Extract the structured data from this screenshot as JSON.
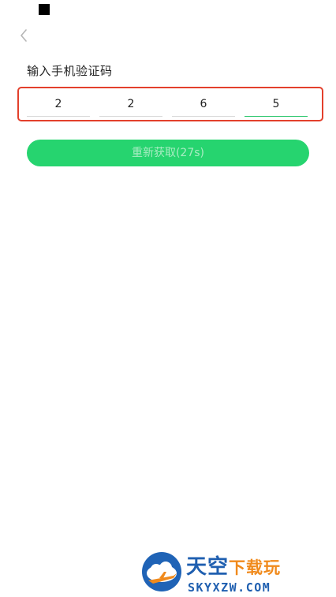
{
  "status_bar": {
    "indicator_icon": "square-icon"
  },
  "nav": {
    "back_icon": "chevron-left-icon"
  },
  "verification": {
    "title": "输入手机验证码",
    "digits": [
      "2",
      "2",
      "6",
      "5"
    ],
    "active_index": 3
  },
  "resend": {
    "label": "重新获取(27s)"
  },
  "watermark": {
    "brand_main": "天空",
    "brand_accent": "下载玩",
    "url": "SKYXZW.COM"
  },
  "colors": {
    "highlight_border": "#e3402c",
    "accent_green": "#26d46f",
    "button_text": "#a8ecc2",
    "active_underline": "#25c568",
    "watermark_blue": "#1f5fb0",
    "watermark_orange": "#f08a1c"
  }
}
